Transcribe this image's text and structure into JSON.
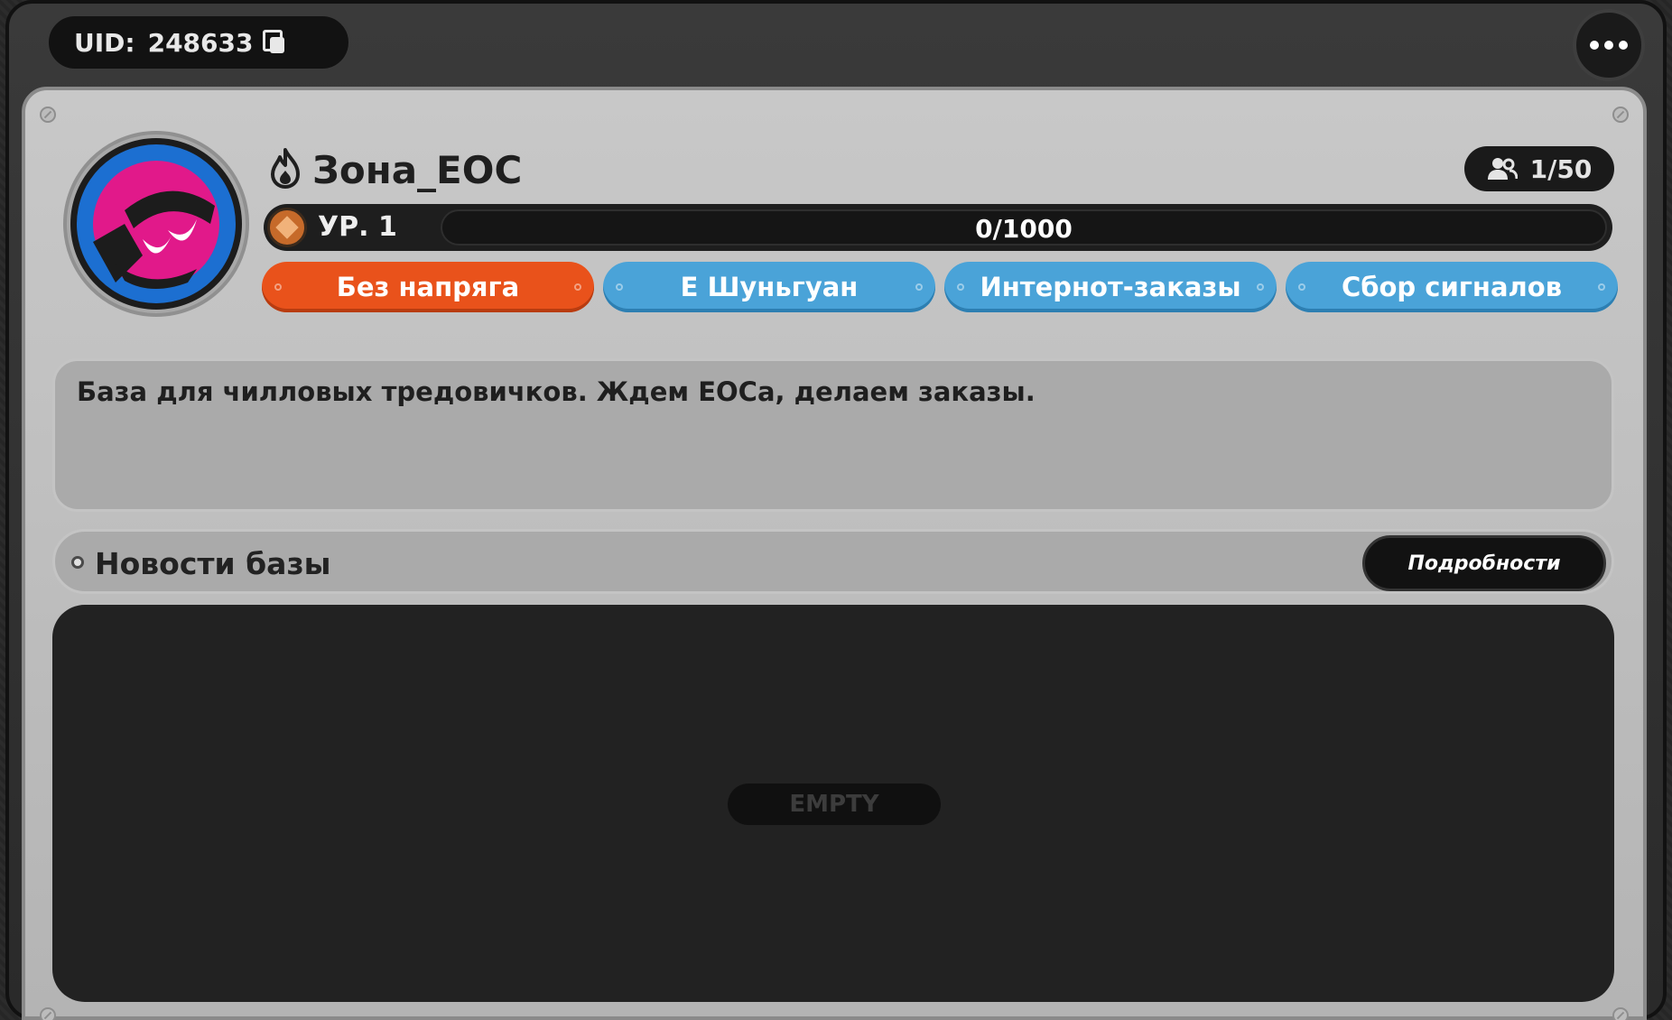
{
  "header": {
    "uid_label": "UID:",
    "uid_value": "248633",
    "copy_icon": "copy-icon",
    "more_icon": "more-dots-icon"
  },
  "base": {
    "name": "Зона_EOC",
    "name_icon": "fire-icon",
    "members": "1/50",
    "members_icon": "users-icon",
    "level_label": "УР. 1",
    "progress_text": "0/1000",
    "progress_fraction": 0,
    "tags": [
      {
        "label": "Без напряга",
        "color": "#e9521b"
      },
      {
        "label": "Е Шуньгуан",
        "color": "#4aa3d8"
      },
      {
        "label": "Интернот-заказы",
        "color": "#4aa3d8"
      },
      {
        "label": "Сбор сигналов",
        "color": "#4aa3d8"
      }
    ],
    "description": "База для чилловых тредовичков. Ждем EOCa, делаем заказы."
  },
  "news": {
    "title": "Новости базы",
    "details_button": "Подробности",
    "empty_label": "EMPTY"
  },
  "colors": {
    "panel": "#bdbdbd",
    "avatar_blue": "#1c6fd1",
    "avatar_pink": "#e1198a"
  }
}
